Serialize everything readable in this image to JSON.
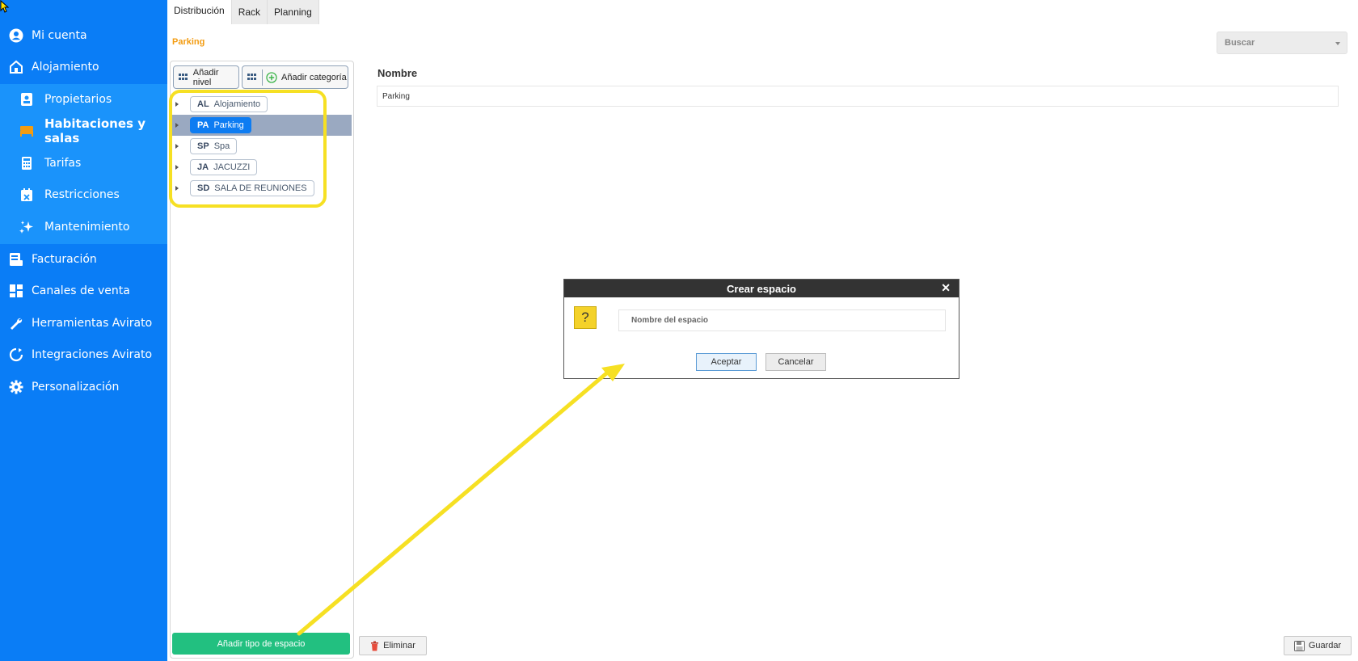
{
  "sidebar": {
    "items": [
      {
        "label": "Mi cuenta",
        "icon": "user-circle-icon"
      },
      {
        "label": "Alojamiento",
        "icon": "house-icon"
      },
      {
        "label": "Propietarios",
        "icon": "id-card-icon"
      },
      {
        "label": "Habitaciones y salas",
        "icon": "bed-icon"
      },
      {
        "label": "Tarifas",
        "icon": "calculator-icon"
      },
      {
        "label": "Restricciones",
        "icon": "calendar-x-icon"
      },
      {
        "label": "Mantenimiento",
        "icon": "sparkle-icon"
      },
      {
        "label": "Facturación",
        "icon": "invoice-icon"
      },
      {
        "label": "Canales de venta",
        "icon": "dashboard-icon"
      },
      {
        "label": "Herramientas Avirato",
        "icon": "wrench-icon"
      },
      {
        "label": "Integraciones Avirato",
        "icon": "sync-icon"
      },
      {
        "label": "Personalización",
        "icon": "gear-icon"
      }
    ]
  },
  "tabs": [
    "Distribución",
    "Rack",
    "Planning"
  ],
  "breadcrumb": "Parking",
  "search": {
    "value": "Buscar"
  },
  "toolbar": {
    "add_level": "Añadir nivel",
    "add_category": "Añadir categoría"
  },
  "tree": [
    {
      "code": "AL",
      "name": "Alojamiento"
    },
    {
      "code": "PA",
      "name": "Parking"
    },
    {
      "code": "SP",
      "name": "Spa"
    },
    {
      "code": "JA",
      "name": "JACUZZI"
    },
    {
      "code": "SD",
      "name": "SALA DE REUNIONES"
    }
  ],
  "add_space_type": "Añadir tipo de espacio",
  "form": {
    "name_label": "Nombre",
    "name_value": "Parking"
  },
  "buttons": {
    "delete": "Eliminar",
    "save": "Guardar"
  },
  "dialog": {
    "title": "Crear espacio",
    "close": "✕",
    "icon_glyph": "?",
    "placeholder": "Nombre del espacio",
    "ok": "Aceptar",
    "cancel": "Cancelar"
  },
  "colors": {
    "sidebar": "#0a7df6",
    "accent": "#f39c12",
    "add_button": "#22c080",
    "highlight": "#f6e023"
  }
}
